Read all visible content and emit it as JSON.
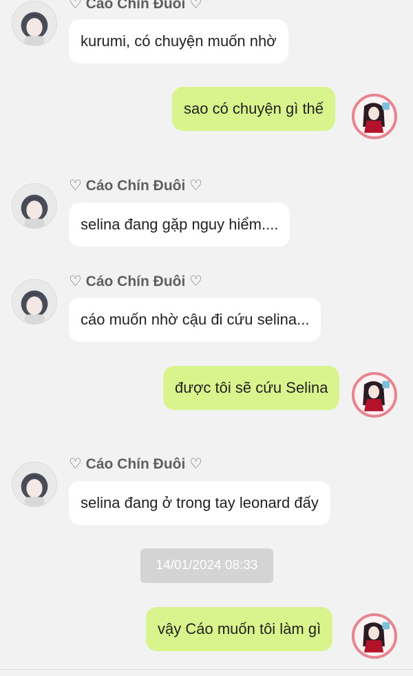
{
  "conversation": {
    "contact_name": "♡ Cáo Chín Đuôi ♡",
    "messages": [
      {
        "side": "in",
        "sender": "♡ Cáo Chín Đuôi ♡",
        "text": "kurumi, có chuyện muốn nhờ"
      },
      {
        "side": "out",
        "text": "sao có chuyện gì thế"
      },
      {
        "side": "in",
        "sender": "♡ Cáo Chín Đuôi ♡",
        "text": "selina đang gặp nguy hiểm...."
      },
      {
        "side": "in",
        "sender": "♡ Cáo Chín Đuôi ♡",
        "text": "cáo muốn nhờ cậu đi cứu selina..."
      },
      {
        "side": "out",
        "text": "được tôi sẽ cứu Selina"
      },
      {
        "side": "in",
        "sender": "♡ Cáo Chín Đuôi ♡",
        "text": "selina đang ở trong tay leonard đấy"
      },
      {
        "side": "out",
        "text": "vậy Cáo muốn tôi làm gì"
      }
    ],
    "timestamp": "14/01/2024 08:33"
  },
  "colors": {
    "background": "#f2f2f2",
    "incoming_bubble": "#ffffff",
    "outgoing_bubble": "#d9f48c",
    "timestamp_pill": "#d4d4d4",
    "sender_name": "#5f5f5f"
  },
  "icons": {
    "contact_avatar": "anime-girl-gray-hair-avatar",
    "self_avatar": "anime-girl-red-dress-avatar"
  }
}
